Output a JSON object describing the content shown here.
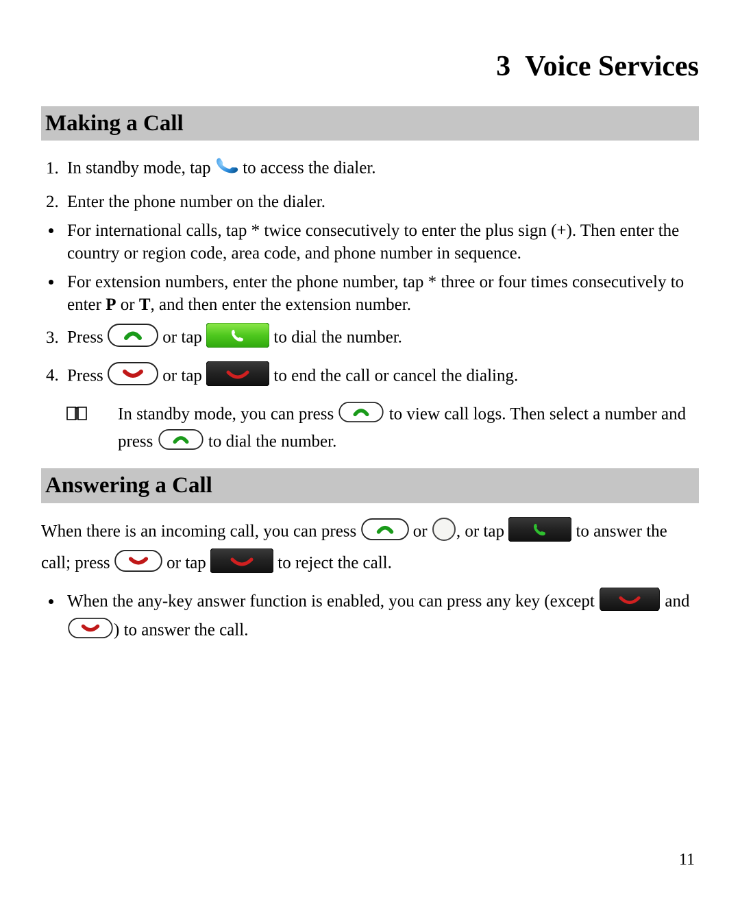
{
  "chapter": {
    "number": "3",
    "title": "Voice Services"
  },
  "section1": {
    "title": "Making a Call",
    "step1a": "In standby mode, tap ",
    "step1b": " to access the dialer.",
    "step2": "Enter the phone number on the dialer.",
    "bullet1": "For international calls, tap * twice consecutively to enter the plus sign (+). Then enter the country or region code, area code, and phone number in sequence.",
    "bullet2a": "For extension numbers, enter the phone number, tap * three or four times consecutively to enter ",
    "bullet2b": "P",
    "bullet2c": " or ",
    "bullet2d": "T",
    "bullet2e": ", and then enter the extension number.",
    "step3a": "Press ",
    "step3b": " or tap ",
    "step3c": " to dial the number.",
    "step4a": "Press ",
    "step4b": " or tap ",
    "step4c": " to end the call or cancel the dialing.",
    "note1a": "In standby mode, you can press ",
    "note1b": " to view call logs. Then select a number and press ",
    "note1c": " to dial the number."
  },
  "section2": {
    "title": "Answering a Call",
    "p1a": "When there is an incoming call, you can press ",
    "p1b": " or ",
    "p1c": ", or tap ",
    "p1d": " to answer the call; press ",
    "p1e": " or tap ",
    "p1f": " to reject the call.",
    "bullet1a": "When the any-key answer function is enabled, you can press any key (except ",
    "bullet1b": " and ",
    "bullet1c": ") to answer the call."
  },
  "page_number": "11"
}
